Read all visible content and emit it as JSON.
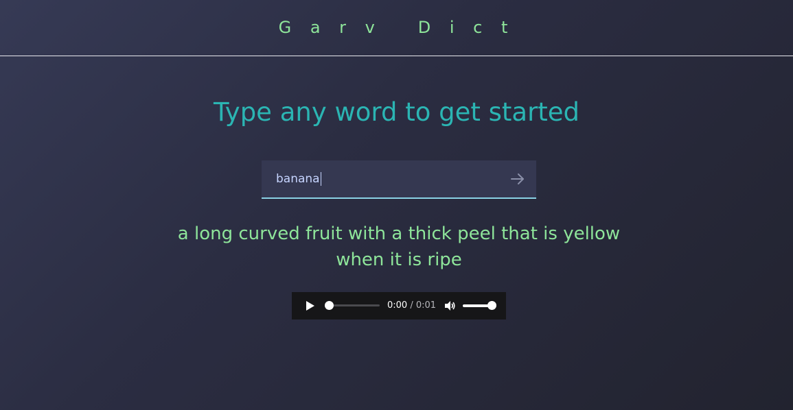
{
  "header": {
    "brand": "G a r v   D i c t"
  },
  "main": {
    "headline": "Type any word to get started",
    "search": {
      "value": "banana",
      "submit_icon": "arrow-right-icon"
    },
    "definition_line1": "a long curved fruit with a thick peel that is yellow",
    "definition_line2": "when it is ripe"
  },
  "audio_player": {
    "current_time": "0:00",
    "separator": " / ",
    "duration": "0:01",
    "playback_progress": 0,
    "volume_level": 1.0,
    "play_icon": "play-icon",
    "volume_icon": "volume-icon"
  },
  "colors": {
    "brand": "#8ee59a",
    "headline": "#2bb5b3",
    "definition": "#8ee59a",
    "search_bg": "#353851",
    "search_underline": "#8bd3e6"
  }
}
